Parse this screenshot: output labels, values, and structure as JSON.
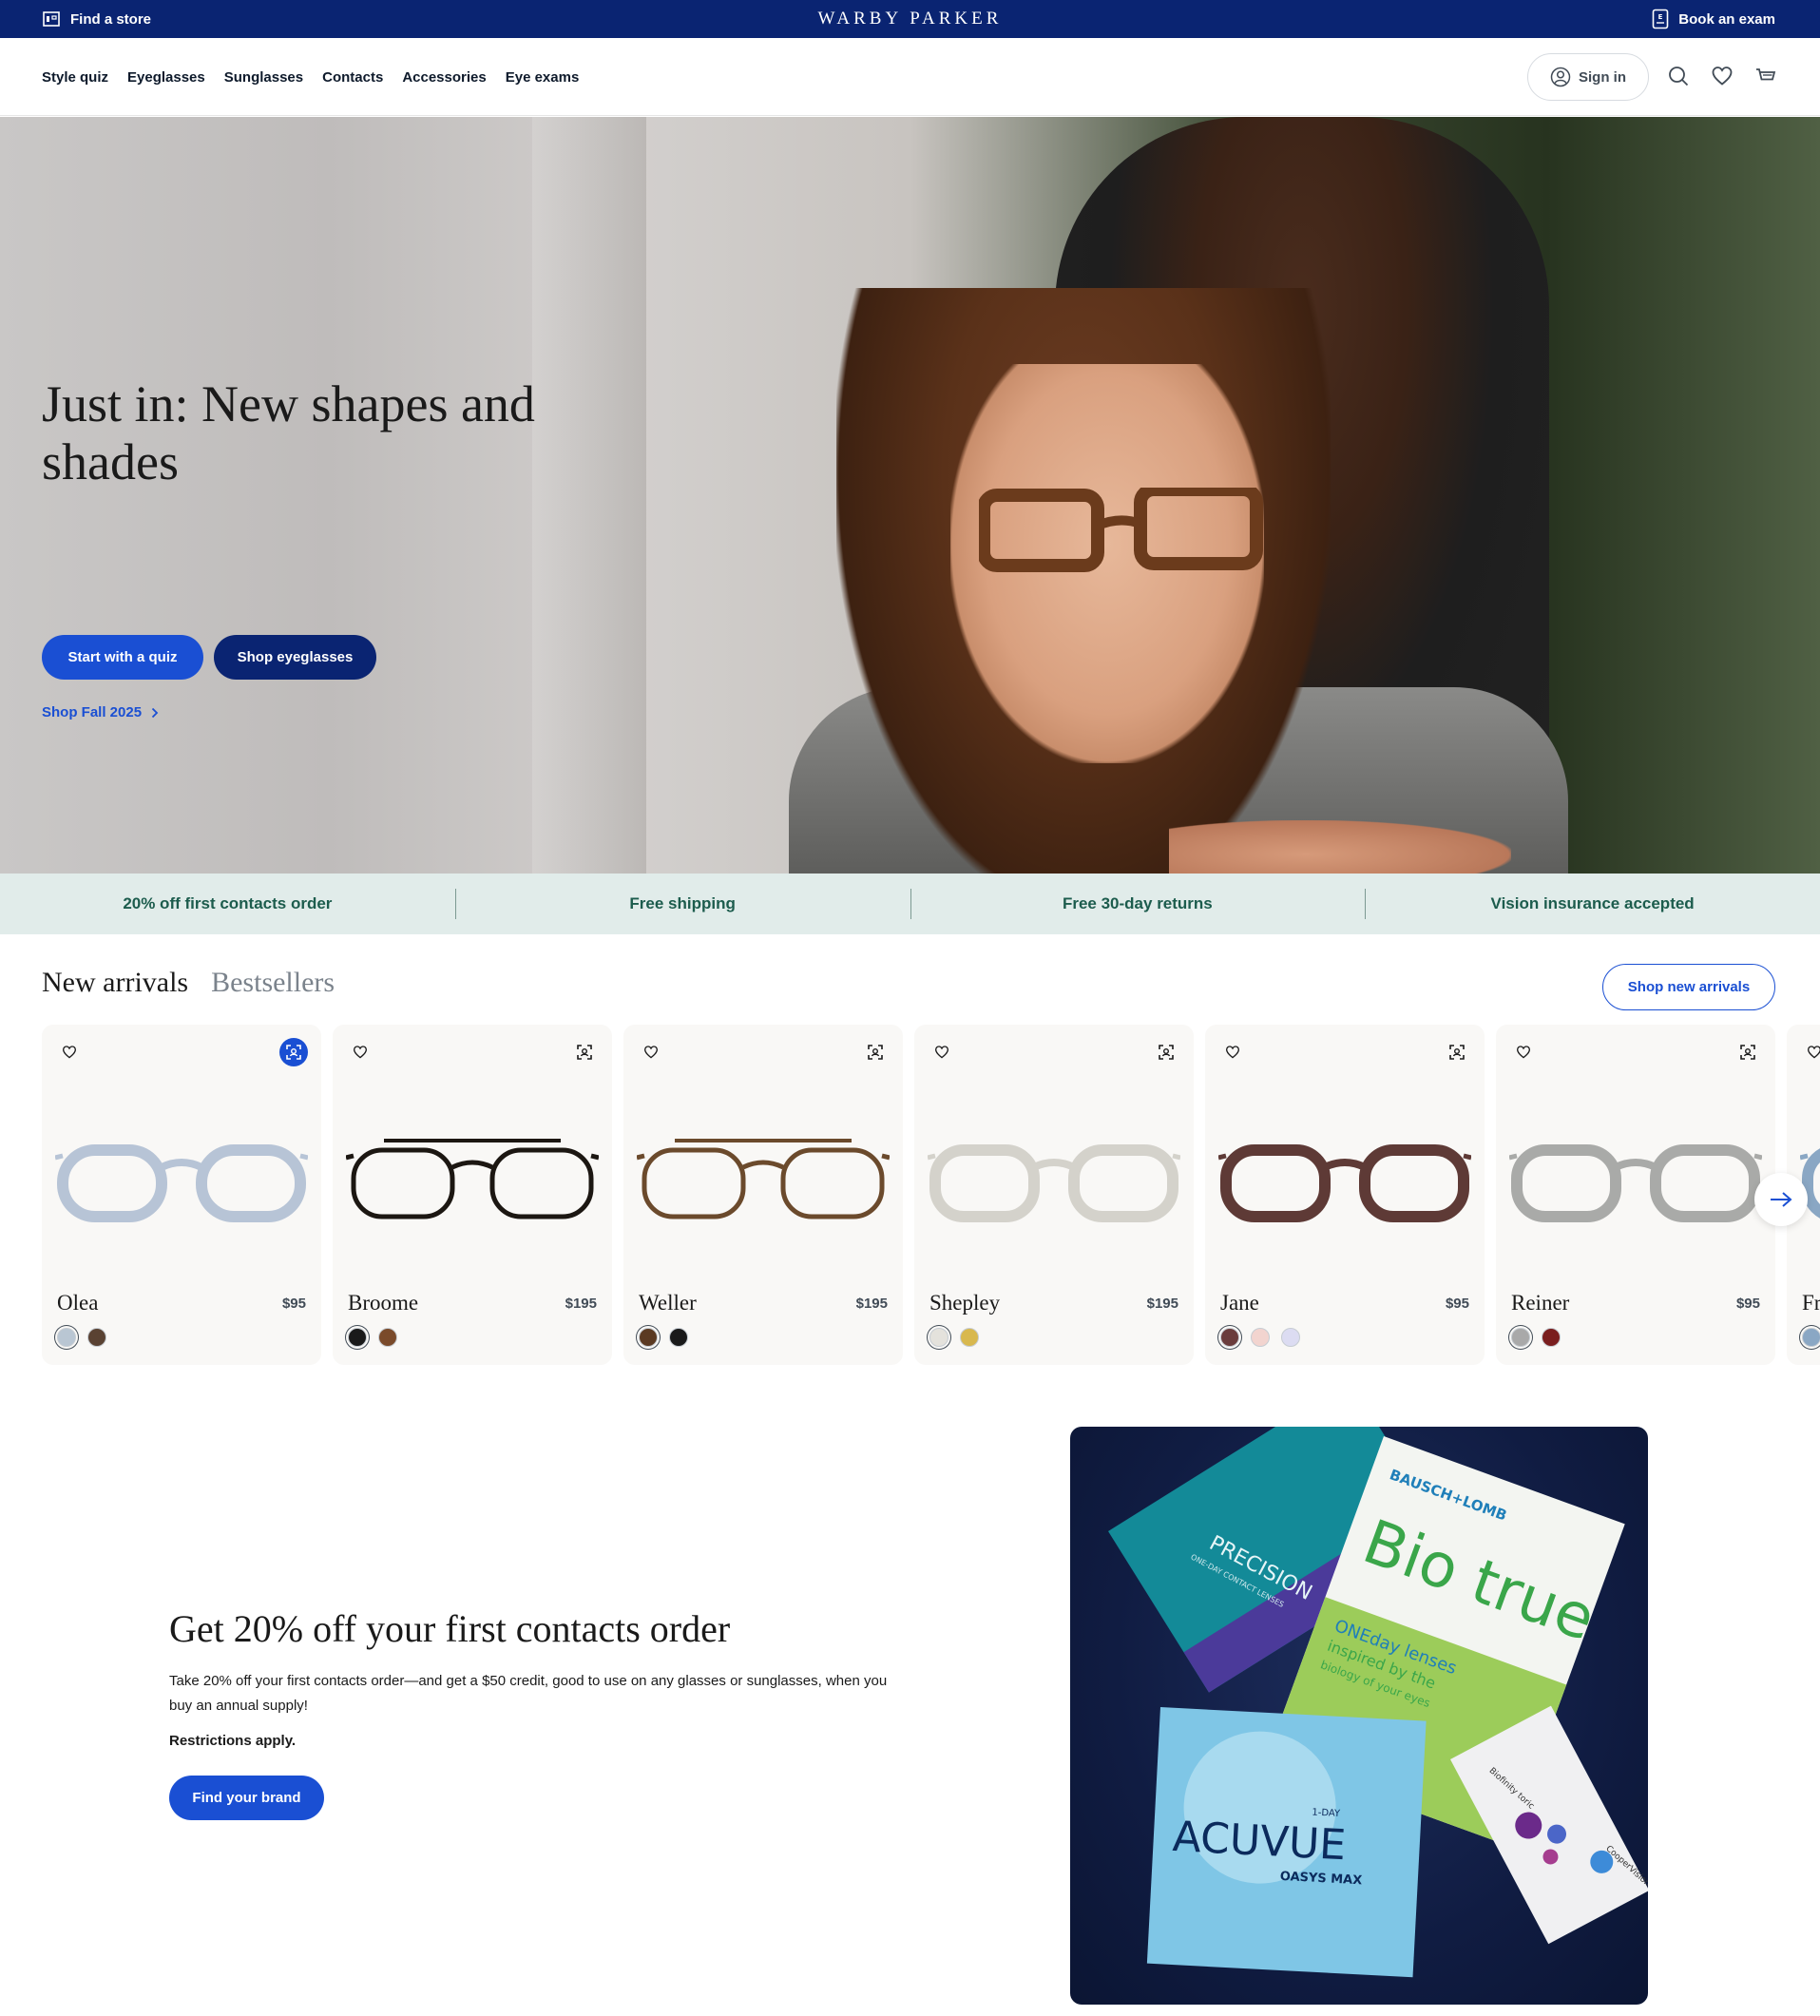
{
  "topbar": {
    "find_store": "Find a store",
    "logo": "WARBY PARKER",
    "book_exam": "Book an exam"
  },
  "nav": {
    "links": [
      "Style quiz",
      "Eyeglasses",
      "Sunglasses",
      "Contacts",
      "Accessories",
      "Eye exams"
    ],
    "sign_in": "Sign in",
    "icons": [
      "search-icon",
      "heart-icon",
      "cart-icon"
    ]
  },
  "hero": {
    "headline": "Just in: New shapes and shades",
    "primary_cta": "Start with a quiz",
    "secondary_cta": "Shop eyeglasses",
    "link": "Shop Fall 2025"
  },
  "benefits": [
    "20% off first contacts order",
    "Free shipping",
    "Free 30-day returns",
    "Vision insurance accepted"
  ],
  "arrivals": {
    "tabs": [
      "New arrivals",
      "Bestsellers"
    ],
    "cta": "Shop new arrivals",
    "products": [
      {
        "name": "Olea",
        "price": "$95",
        "swatches": [
          "#b9c6d3",
          "#5a4232"
        ],
        "frame_color": "#b7c4d6"
      },
      {
        "name": "Broome",
        "price": "$195",
        "swatches": [
          "#1a1a1a",
          "#7a4a2a"
        ],
        "frame_color": "#1c1712"
      },
      {
        "name": "Weller",
        "price": "$195",
        "swatches": [
          "#5b3a22",
          "#1a1a1a"
        ],
        "frame_color": "#6b4a2c"
      },
      {
        "name": "Shepley",
        "price": "$195",
        "swatches": [
          "#e4e2dc",
          "#d8b84e"
        ],
        "frame_color": "#d4d2cb"
      },
      {
        "name": "Jane",
        "price": "$95",
        "swatches": [
          "#6a3c3c",
          "#f2d4cf",
          "#dcdcf2"
        ],
        "frame_color": "#5e3a36"
      },
      {
        "name": "Reiner",
        "price": "$95",
        "swatches": [
          "#a9a9a9",
          "#7a1e1e"
        ],
        "frame_color": "#a9aaa8"
      },
      {
        "name": "Fr",
        "price": "",
        "swatches": [
          "#8aa7c4"
        ],
        "frame_color": "#8aa7c4"
      }
    ]
  },
  "promo": {
    "headline": "Get 20% off your first contacts order",
    "description": "Take 20% off your first contacts order—and get a $50 credit, good to use on any glasses or sunglasses, when you buy an annual supply!",
    "restrictions": "Restrictions apply.",
    "cta": "Find your brand",
    "boxes": {
      "precision_brand": "PRECISION",
      "precision_sub": "ONE-DAY CONTACT LENSES",
      "biotrue_maker": "BAUSCH+LOMB",
      "biotrue_brand": "Bio true",
      "biotrue_line1": "ONEday lenses",
      "biotrue_line2": "inspired by the",
      "biotrue_line3": "biology of your eyes",
      "acuvue_brand": "ACUVUE",
      "acuvue_sub": "OASYS MAX",
      "acuvue_tag": "1-DAY",
      "cooper_brand": "CooperVision",
      "cooper_product": "Biofinity toric"
    }
  },
  "colors": {
    "navy": "#0a2472",
    "blue": "#1a4fd3",
    "mint": "#e1ecea",
    "green_text": "#1c5c4d"
  }
}
